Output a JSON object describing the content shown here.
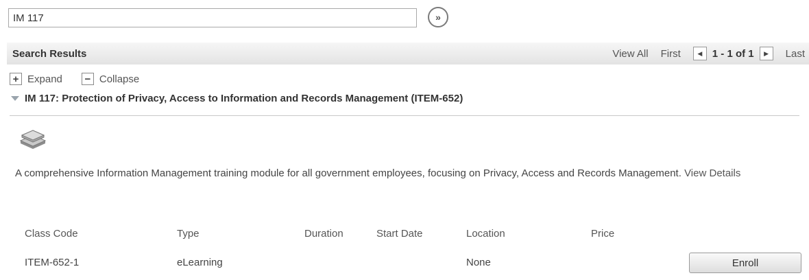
{
  "search": {
    "value": "IM 117",
    "go_label": "»"
  },
  "results": {
    "title": "Search Results",
    "pager": {
      "view_all": "View All",
      "first": "First",
      "count": "1 - 1 of 1",
      "last": "Last"
    }
  },
  "controls": {
    "expand": "Expand",
    "collapse": "Collapse"
  },
  "item": {
    "title": "IM 117: Protection of Privacy, Access to Information and Records Management (ITEM-652)",
    "description": "A comprehensive Information Management training module for all government employees, focusing on Privacy, Access and Records Management.",
    "view_details": "View Details"
  },
  "table": {
    "headers": {
      "class_code": "Class Code",
      "type": "Type",
      "duration": "Duration",
      "start_date": "Start Date",
      "location": "Location",
      "price": "Price"
    },
    "rows": [
      {
        "class_code": "ITEM-652-1",
        "type": "eLearning",
        "duration": "",
        "start_date": "",
        "location": "None",
        "price": "",
        "action": "Enroll"
      }
    ]
  },
  "icons": {
    "go": "go-arrow-icon",
    "prev": "prev-page-icon",
    "next": "next-page-icon",
    "expand": "plus-box-icon",
    "collapse": "minus-box-icon",
    "item": "book-stack-icon"
  }
}
